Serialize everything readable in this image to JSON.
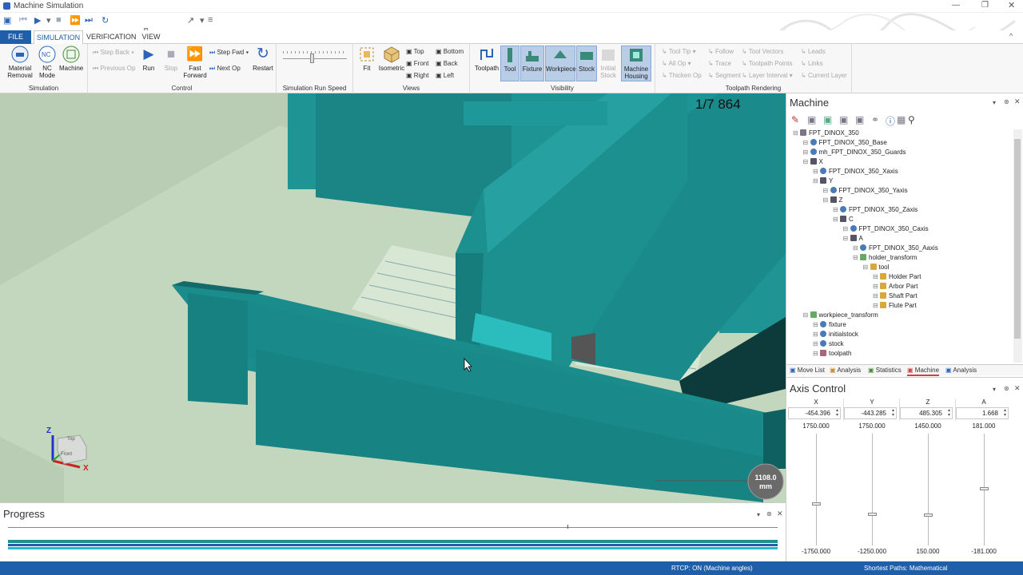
{
  "window": {
    "title": "Machine Simulation"
  },
  "tabs": [
    {
      "label": "FILE",
      "kind": "file"
    },
    {
      "label": "SIMULATION",
      "kind": "active"
    },
    {
      "label": "VERIFICATION",
      "kind": "normal"
    },
    {
      "label": "VIEW",
      "kind": "normal"
    }
  ],
  "ribbon": {
    "simulation": {
      "label": "Simulation",
      "material_removal": "Material Removal",
      "nc_mode": "NC Mode",
      "machine": "Machine"
    },
    "control": {
      "label": "Control",
      "step_back": "Step Back",
      "previous_op": "Previous Op",
      "run": "Run",
      "stop": "Stop",
      "fast_forward": "Fast Forward",
      "step_fwd": "Step Fwd",
      "next_op": "Next Op",
      "restart": "Restart"
    },
    "speed": {
      "label": "Simulation Run Speed"
    },
    "views": {
      "label": "Views",
      "fit": "Fit",
      "isometric": "Isometric",
      "top": "Top",
      "bottom": "Bottom",
      "front": "Front",
      "back": "Back",
      "right": "Right",
      "left": "Left"
    },
    "visibility": {
      "label": "Visibility",
      "toolpath": "Toolpath",
      "tool": "Tool",
      "fixture": "Fixture",
      "workpiece": "Workpiece",
      "stock": "Stock",
      "initial_stock": "Initial Stock",
      "machine_housing": "Machine Housing"
    },
    "rendering": {
      "label": "Toolpath Rendering",
      "tool_tip": "Tool Tip",
      "all_op": "All Op",
      "thicken_op": "Thicken Op",
      "follow": "Follow",
      "trace": "Trace",
      "segment": "Segment",
      "tool_vectors": "Tool Vectors",
      "toolpath_points": "Toolpath Points",
      "layer_interval": "Layer Interval",
      "leads": "Leads",
      "links": "Links",
      "current_layer": "Current Layer"
    }
  },
  "viewport": {
    "counter": "1/7 864",
    "scale_value": "1108.0",
    "scale_unit": "mm",
    "axis_z": "Z",
    "axis_x": "X",
    "cube_top": "Top",
    "cube_front": "Front"
  },
  "machine_panel": {
    "title": "Machine",
    "tree": [
      {
        "label": "FPT_DINOX_350",
        "depth": 0,
        "icon": "machine-icon"
      },
      {
        "label": "FPT_DINOX_350_Base",
        "depth": 1,
        "icon": "model-icon"
      },
      {
        "label": "mh_FPT_DINOX_350_Guards",
        "depth": 1,
        "icon": "model-icon"
      },
      {
        "label": "X",
        "depth": 1,
        "icon": "axis-icon"
      },
      {
        "label": "FPT_DINOX_350_Xaxis",
        "depth": 2,
        "icon": "model-icon"
      },
      {
        "label": "Y",
        "depth": 2,
        "icon": "axis-icon"
      },
      {
        "label": "FPT_DINOX_350_Yaxis",
        "depth": 3,
        "icon": "model-icon"
      },
      {
        "label": "Z",
        "depth": 3,
        "icon": "axis-icon"
      },
      {
        "label": "FPT_DINOX_350_Zaxis",
        "depth": 4,
        "icon": "model-icon"
      },
      {
        "label": "C",
        "depth": 4,
        "icon": "rotary-icon"
      },
      {
        "label": "FPT_DINOX_350_Caxis",
        "depth": 5,
        "icon": "model-icon"
      },
      {
        "label": "A",
        "depth": 5,
        "icon": "rotary-icon"
      },
      {
        "label": "FPT_DINOX_350_Aaxis",
        "depth": 6,
        "icon": "model-icon"
      },
      {
        "label": "holder_transform",
        "depth": 6,
        "icon": "transform-icon"
      },
      {
        "label": "tool",
        "depth": 7,
        "icon": "folder-icon"
      },
      {
        "label": "Holder Part",
        "depth": 8,
        "icon": "part-icon"
      },
      {
        "label": "Arbor Part",
        "depth": 8,
        "icon": "part-icon"
      },
      {
        "label": "Shaft Part",
        "depth": 8,
        "icon": "part-icon"
      },
      {
        "label": "Flute Part",
        "depth": 8,
        "icon": "part-icon"
      },
      {
        "label": "workpiece_transform",
        "depth": 1,
        "icon": "transform-icon"
      },
      {
        "label": "fixture",
        "depth": 2,
        "icon": "model-icon"
      },
      {
        "label": "initialstock",
        "depth": 2,
        "icon": "model-icon"
      },
      {
        "label": "stock",
        "depth": 2,
        "icon": "model-icon"
      },
      {
        "label": "toolpath",
        "depth": 2,
        "icon": "toolpath-icon"
      }
    ],
    "bottom_tabs": [
      {
        "label": "Move List",
        "active": false
      },
      {
        "label": "Analysis",
        "active": false
      },
      {
        "label": "Statistics",
        "active": false
      },
      {
        "label": "Machine",
        "active": true
      },
      {
        "label": "Analysis",
        "active": false
      }
    ]
  },
  "axis_control": {
    "title": "Axis Control",
    "axes": [
      {
        "name": "X",
        "value": "-454.396",
        "max": "1750.000",
        "min": "-1750.000",
        "level": 0.37
      },
      {
        "name": "Y",
        "value": "-443.285",
        "max": "1750.000",
        "min": "-1250.000",
        "level": 0.28
      },
      {
        "name": "Z",
        "value": "485.305",
        "max": "1450.000",
        "min": "150.000",
        "level": 0.27
      },
      {
        "name": "A",
        "value": "1.668",
        "max": "181.000",
        "min": "-181.000",
        "level": 0.51
      }
    ]
  },
  "progress": {
    "title": "Progress",
    "position": 0.727
  },
  "status": {
    "rtcp": "RTCP: ON (Machine angles)",
    "paths": "Shortest Paths: Mathematical"
  },
  "colors": {
    "accent": "#1f5ea8",
    "machine": "#1a8a8a",
    "floor": "#b5cbb0"
  }
}
